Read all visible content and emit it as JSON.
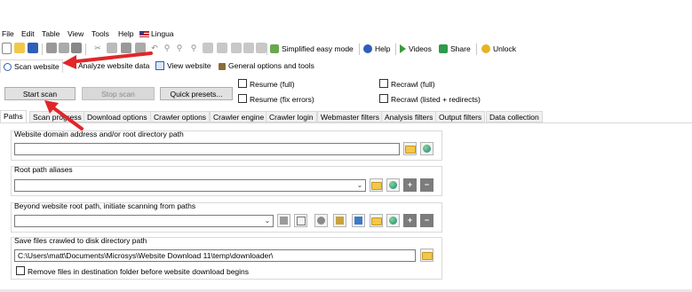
{
  "menu": [
    "File",
    "Edit",
    "Table",
    "View",
    "Tools",
    "Help",
    "Lingua"
  ],
  "toolbar": {
    "simplified_mode": "Simplified easy mode",
    "help": "Help",
    "videos": "Videos",
    "share": "Share",
    "unlock": "Unlock"
  },
  "top_tabs": {
    "scan_website": "Scan website",
    "analyze": "Analyze website data",
    "view_website": "View website",
    "general_options": "General options and tools"
  },
  "actions": {
    "start_scan": "Start scan",
    "stop_scan": "Stop scan",
    "quick_presets": "Quick presets..."
  },
  "checkboxes": {
    "resume_full": "Resume (full)",
    "resume_fix": "Resume (fix errors)",
    "recrawl_full": "Recrawl (full)",
    "recrawl_listed": "Recrawl (listed + redirects)"
  },
  "tabs": [
    "Paths",
    "Scan progress",
    "Download options",
    "Crawler options",
    "Crawler engine",
    "Crawler login",
    "Webmaster filters",
    "Analysis filters",
    "Output filters",
    "Data collection"
  ],
  "paths": {
    "domain_label": "Website domain address and/or root directory path",
    "domain_value": "",
    "aliases_label": "Root path aliases",
    "aliases_value": "",
    "beyond_label": "Beyond website root path, initiate scanning from paths",
    "beyond_value": "",
    "save_label": "Save files crawled to disk directory path",
    "save_value": "C:\\Users\\matt\\Documents\\Microsys\\Website Download 11\\temp\\downloader\\",
    "remove_files_label": "Remove files in destination folder before website download begins"
  },
  "colors": {
    "arrow": "#e0262a",
    "tab_border": "#d9d9d9",
    "button_bg": "#e1e1e1"
  }
}
